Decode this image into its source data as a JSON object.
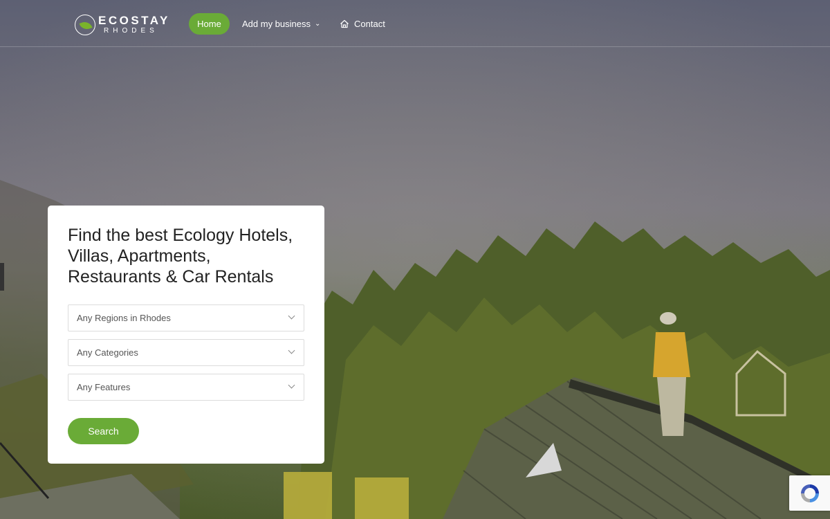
{
  "brand": {
    "name": "ECOSTAY",
    "subtitle": "RHODES"
  },
  "nav": {
    "items": [
      "Home",
      "Add my business",
      "Contact"
    ],
    "active": "Home"
  },
  "search_card": {
    "heading": "Find the best Ecology Hotels, Villas, Apartments, Restaurants & Car Rentals",
    "selects": [
      {
        "value": "Any Regions in Rhodes"
      },
      {
        "value": "Any Categories"
      },
      {
        "value": "Any Features"
      }
    ],
    "button_label": "Search"
  },
  "colors": {
    "accent": "#6aab37",
    "card_bg": "#ffffff"
  },
  "icons": {
    "nav_contact": "home-outline-icon",
    "dropdown": "chevron-down-icon",
    "recaptcha": "recaptcha-icon"
  }
}
